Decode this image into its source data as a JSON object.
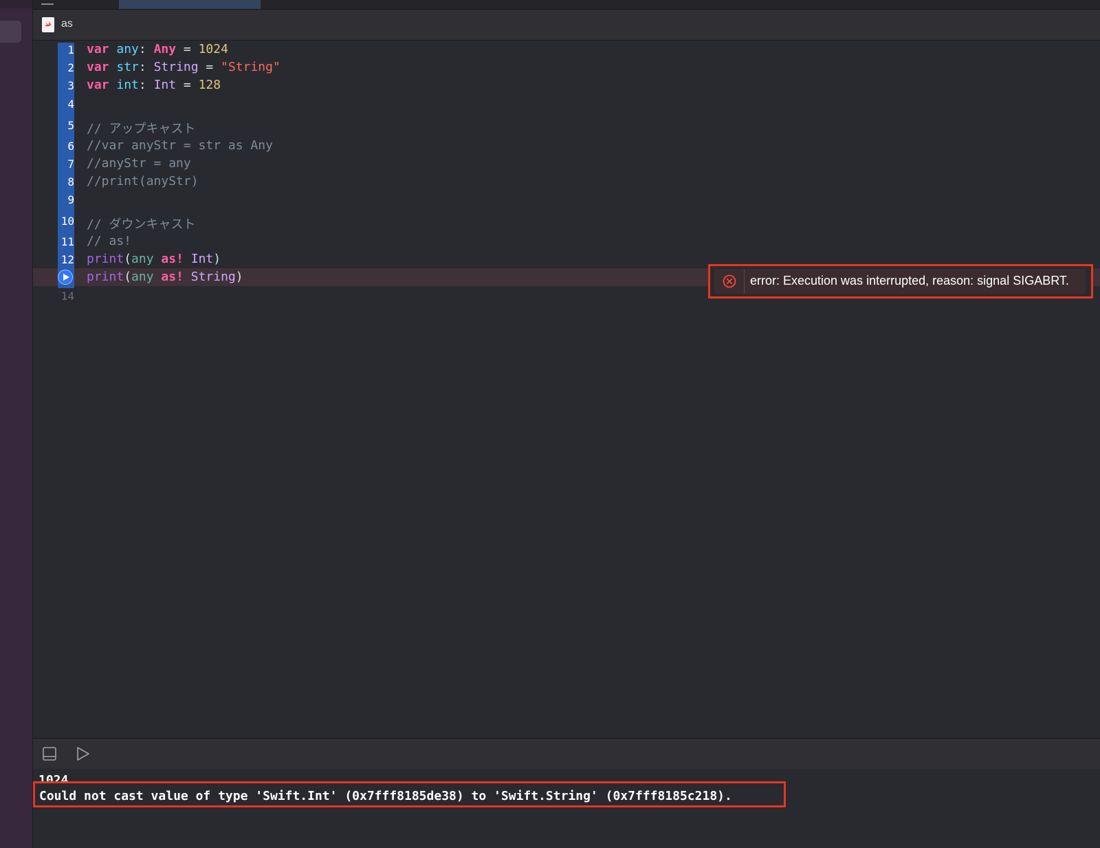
{
  "editor": {
    "file_name": "as",
    "line_numbers": [
      "1",
      "2",
      "3",
      "4",
      "5",
      "6",
      "7",
      "8",
      "9",
      "10",
      "11",
      "12",
      "14"
    ],
    "lines": {
      "l1": {
        "kw": "var",
        "name": "any",
        "colon": ": ",
        "type": "Any",
        "eq": " = ",
        "value": "1024"
      },
      "l2": {
        "kw": "var",
        "name": "str",
        "colon": ": ",
        "type": "String",
        "eq": " = ",
        "value": "\"String\""
      },
      "l3": {
        "kw": "var",
        "name": "int",
        "colon": ": ",
        "type": "Int",
        "eq": " = ",
        "value": "128"
      },
      "l5": "// アップキャスト",
      "l6": "//var anyStr = str as Any",
      "l7": "//anyStr = any",
      "l8": "//print(anyStr)",
      "l10": "// ダウンキャスト",
      "l11": "// as!",
      "l12": {
        "fn": "print",
        "open": "(",
        "arg": "any",
        "sp": " ",
        "kw": "as!",
        "type": " Int",
        "close": ")"
      },
      "l13": {
        "fn": "print",
        "open": "(",
        "arg": "any",
        "sp": " ",
        "kw": "as!",
        "type": " String",
        "close": ")"
      }
    },
    "error_message": "error: Execution was interrupted, reason: signal SIGABRT."
  },
  "debug": {
    "toggle_icon": "panel-toggle-icon",
    "run_icon": "run-triangle-icon"
  },
  "console": {
    "output_line": "1024",
    "error_line": "Could not cast value of type 'Swift.Int' (0x7fff8185de38) to 'Swift.String' (0x7fff8185c218)."
  },
  "colors": {
    "keyword": "#fc5fa3",
    "type": "#d0a8ff",
    "number": "#d9c97c",
    "string": "#fc6a5d",
    "comment": "#7f8c98",
    "highlight_border": "#e8361e"
  }
}
